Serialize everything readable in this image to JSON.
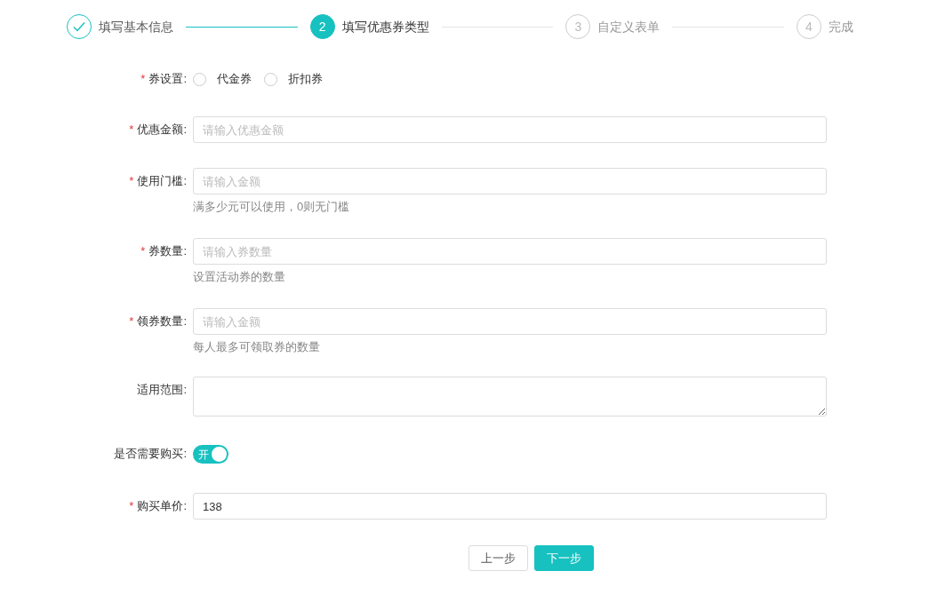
{
  "steps": [
    {
      "label": "填写基本信息",
      "completed": true,
      "selected": false
    },
    {
      "number": "2",
      "label": "填写优惠券类型",
      "completed": false,
      "selected": true
    },
    {
      "number": "3",
      "label": "自定义表单",
      "completed": false,
      "selected": false
    },
    {
      "number": "4",
      "label": "完成",
      "completed": false,
      "selected": false
    }
  ],
  "fields": [
    {
      "kind": "radio",
      "required_mark": "*",
      "label": "券设置:",
      "options": [
        {
          "label": "代金券",
          "selected": false
        },
        {
          "label": "折扣券",
          "selected": false
        }
      ]
    },
    {
      "kind": "input",
      "required_mark": "*",
      "label": "优惠金额:",
      "placeholder": "请输入优惠金额"
    },
    {
      "kind": "input",
      "required_mark": "*",
      "label": "使用门槛:",
      "placeholder": "请输入金额",
      "hint": "满多少元可以使用，0则无门槛"
    },
    {
      "kind": "input",
      "required_mark": "*",
      "label": "券数量:",
      "placeholder": "请输入券数量",
      "hint": "设置活动券的数量"
    },
    {
      "kind": "input",
      "required_mark": "*",
      "label": "领券数量:",
      "placeholder": "请输入金额",
      "hint": "每人最多可领取券的数量"
    },
    {
      "kind": "textarea",
      "label": "适用范围:"
    },
    {
      "kind": "switch",
      "label": "是否需要购买:",
      "on": true,
      "switch_text": "开"
    },
    {
      "kind": "input",
      "required_mark": "*",
      "label": "购买单价:",
      "value": "138"
    }
  ],
  "buttons": [
    {
      "label": "上一步",
      "kind": "secondary"
    },
    {
      "label": "下一步",
      "kind": "primary"
    }
  ]
}
